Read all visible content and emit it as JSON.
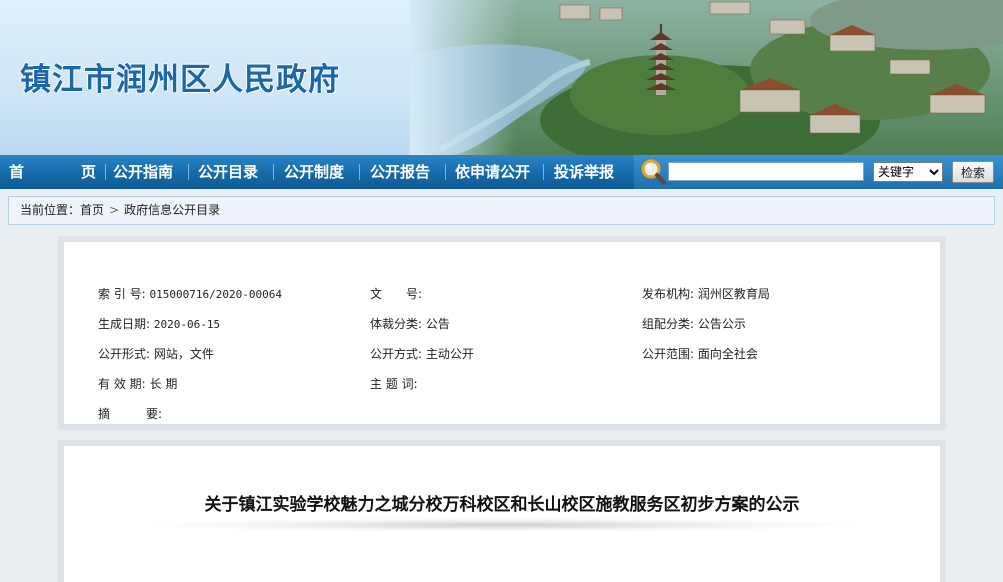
{
  "header": {
    "site_title": "镇江市润州区人民政府"
  },
  "nav": {
    "home_a": "首",
    "home_b": "页",
    "items": [
      "公开指南",
      "公开目录",
      "公开制度",
      "公开报告",
      "依申请公开",
      "投诉举报"
    ]
  },
  "search": {
    "input_value": "",
    "select_value": "关键字",
    "button_label": "检索"
  },
  "breadcrumb": {
    "prefix": "当前位置：",
    "home": "首页",
    "separator": ">",
    "current": "政府信息公开目录"
  },
  "meta": {
    "index_no_label": "索 引 号:",
    "index_no_value": "015000716/2020-00064",
    "doc_no_label": "文　　号:",
    "doc_no_value": "",
    "publisher_label": "发布机构:",
    "publisher_value": "润州区教育局",
    "date_label": "生成日期:",
    "date_value": "2020-06-15",
    "genre_label": "体裁分类:",
    "genre_value": "公告",
    "group_label": "组配分类:",
    "group_value": "公告公示",
    "form_label": "公开形式:",
    "form_value": "网站，文件",
    "method_label": "公开方式:",
    "method_value": "主动公开",
    "scope_label": "公开范围:",
    "scope_value": "面向全社会",
    "validity_label": "有 效 期:",
    "validity_value": "长 期",
    "keywords_label": "主 题 词:",
    "keywords_value": "",
    "abstract_label": "摘　　　要:",
    "abstract_value": ""
  },
  "document": {
    "title": "关于镇江实验学校魅力之城分校万科校区和长山校区施教服务区初步方案的公示"
  },
  "colors": {
    "nav_blue": "#166aa9",
    "title_blue": "#1b67a8",
    "breadcrumb_bg": "#eef4fa"
  }
}
